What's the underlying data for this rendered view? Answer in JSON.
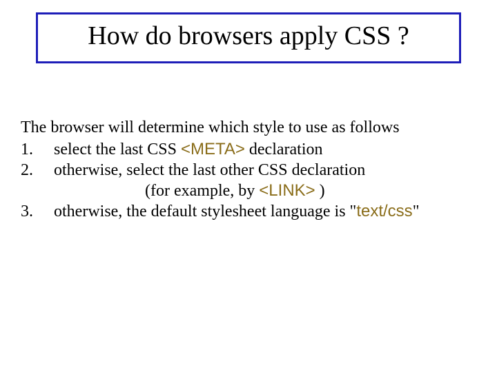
{
  "title": "How do browsers apply CSS ?",
  "intro": "The browser will determine which style to use as follows",
  "items": [
    {
      "num": "1.",
      "pre": "select the last CSS ",
      "code": "<META>",
      "post": " declaration"
    },
    {
      "num": "2.",
      "pre": "otherwise, select the last other CSS declaration",
      "cont_pre": "(for example, by ",
      "cont_code": "<LINK>",
      "cont_post": " )"
    },
    {
      "num": "3.",
      "pre": "otherwise, the default stylesheet language is \"",
      "code": "text/css",
      "post": "\""
    }
  ]
}
